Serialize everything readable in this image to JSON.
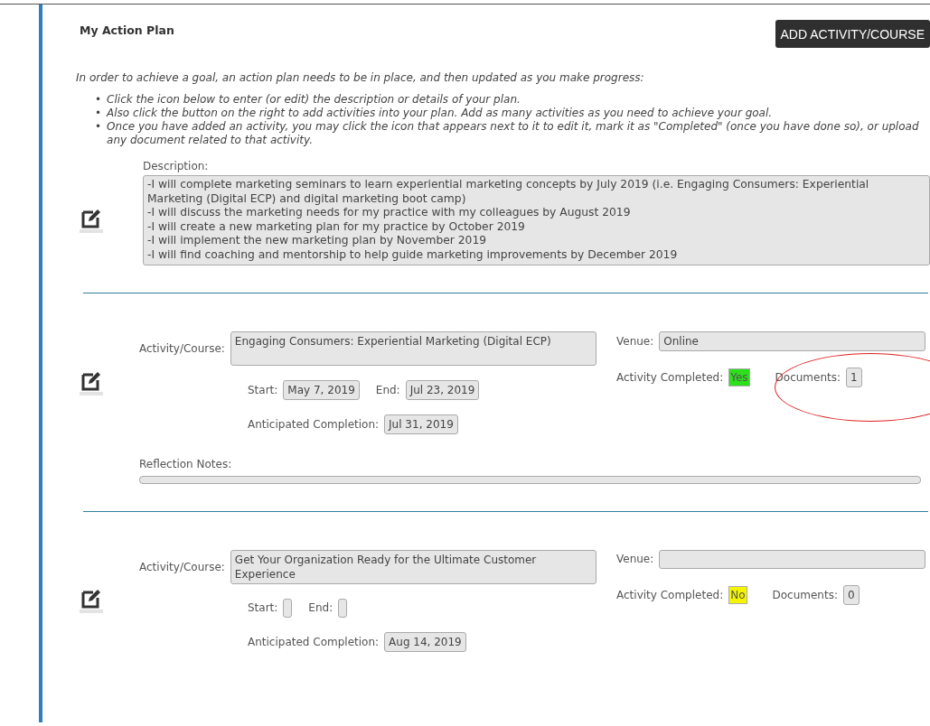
{
  "title": "My Action Plan",
  "add_button": "ADD ACTIVITY/COURSE",
  "intro": "In order to achieve a goal, an action plan needs to be in place, and then updated as you make progress:",
  "bullets": [
    {
      "marker": "•",
      "text": "Click the icon below to enter (or edit) the description or details of your plan."
    },
    {
      "marker": "•",
      "text": "Also click the button on the right to add activities into your plan. Add as many activities as you need to achieve your goal."
    },
    {
      "marker": "•",
      "text": "Once you have added an activity, you may click the icon that appears next to it to edit it, mark it as \"Completed\" (once you have done so), or upload any document related to that activity."
    }
  ],
  "description": {
    "label": "Description:",
    "lines": [
      "-I will complete marketing seminars to learn experiential marketing concepts by July 2019 (i.e. Engaging Consumers: Experiential Marketing (Digital ECP) and digital marketing boot camp)",
      "-I will discuss the marketing needs for my practice with my colleagues by August 2019",
      "-I will create a new marketing plan for my practice by October 2019",
      "-I will implement the new marketing plan by November 2019",
      "-I will find coaching and mentorship to help guide marketing improvements by December 2019"
    ]
  },
  "activities": [
    {
      "course_label": "Activity/Course:",
      "course": "Engaging Consumers: Experiential Marketing (Digital ECP)",
      "venue_label": "Venue:",
      "venue": "Online",
      "completed_label": "Activity Completed:",
      "completed": true,
      "completed_text": "Yes",
      "documents_label": "Documents:",
      "documents": "1",
      "circled": true,
      "start_label": "Start:",
      "start": "May 7, 2019",
      "end_label": "End:",
      "end": "Jul 23, 2019",
      "anticipated_label": "Anticipated Completion:",
      "anticipated": "Jul 31, 2019",
      "reflection_label": "Reflection Notes:"
    },
    {
      "course_label": "Activity/Course:",
      "course": "Get Your Organization Ready for the Ultimate Customer Experience",
      "venue_label": "Venue:",
      "completed_label": "Activity Completed:",
      "completed": false,
      "completed_text": "No",
      "documents_label": "Documents:",
      "documents": "0",
      "start_label": "Start:",
      "end_label": "End:",
      "anticipated_label": "Anticipated Completion:",
      "anticipated": "Aug 14, 2019"
    }
  ]
}
